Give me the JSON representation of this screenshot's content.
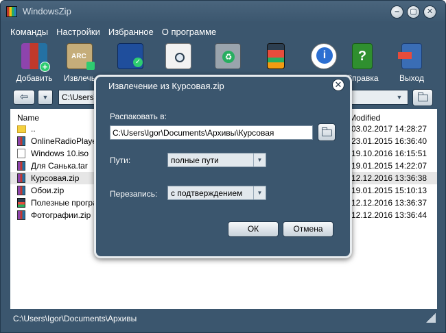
{
  "window": {
    "title": "WindowsZip"
  },
  "window_controls": {
    "minimize_glyph": "‒",
    "maximize_glyph": "▢",
    "close_glyph": "✕"
  },
  "menu": [
    "Команды",
    "Настройки",
    "Избранное",
    "О программе"
  ],
  "toolbar": [
    {
      "label": "Добавить",
      "icon": "add-archive-icon"
    },
    {
      "label": "Извлечь",
      "icon": "extract-icon"
    },
    {
      "label": "",
      "icon": "test-icon"
    },
    {
      "label": "",
      "icon": "view-icon"
    },
    {
      "label": "",
      "icon": "delete-icon"
    },
    {
      "label": "",
      "icon": "wizard-icon"
    },
    {
      "label": "",
      "icon": "info-icon"
    },
    {
      "label": "Справка",
      "icon": "help-icon"
    },
    {
      "label": "Выход",
      "icon": "exit-icon"
    }
  ],
  "pathbar": {
    "value": "C:\\Users\\"
  },
  "filelist": {
    "columns": {
      "name": "Name",
      "modified": "Modified"
    },
    "rows": [
      {
        "name": "..",
        "modified": "03.02.2017 14:28:27",
        "type": "folder"
      },
      {
        "name": "OnlineRadioPlayer.",
        "modified": "23.01.2015 16:36:40",
        "type": "archive"
      },
      {
        "name": "Windows 10.iso",
        "modified": "19.10.2016 16:15:51",
        "type": "doc"
      },
      {
        "name": "Для Санька.tar",
        "modified": "19.01.2015 14:22:07",
        "type": "archive"
      },
      {
        "name": "Курсовая.zip",
        "modified": "12.12.2016 13:36:38",
        "type": "archive"
      },
      {
        "name": "Обои.zip",
        "modified": "19.01.2015 15:10:13",
        "type": "archive"
      },
      {
        "name": "Полезные програ",
        "modified": "12.12.2016 13:36:37",
        "type": "app"
      },
      {
        "name": "Фотографии.zip",
        "modified": "12.12.2016 13:36:44",
        "type": "archive"
      }
    ]
  },
  "status": "C:\\Users\\Igor\\Documents\\Архивы",
  "dialog": {
    "title": "Извлечение из Курсовая.zip",
    "close_glyph": "✕",
    "extract_label": "Распаковать в:",
    "extract_path": "C:\\Users\\Igor\\Documents\\Архивы\\Курсовая",
    "paths_label": "Пути:",
    "paths_value": "полные пути",
    "overwrite_label": "Перезапись:",
    "overwrite_value": "с подтверждением",
    "ok_label": "ОК",
    "cancel_label": "Отмена"
  },
  "colors": {
    "window_bg": "#3b566e",
    "dialog_border": "#e8ecef",
    "selected_row": "#e6e6e6"
  }
}
